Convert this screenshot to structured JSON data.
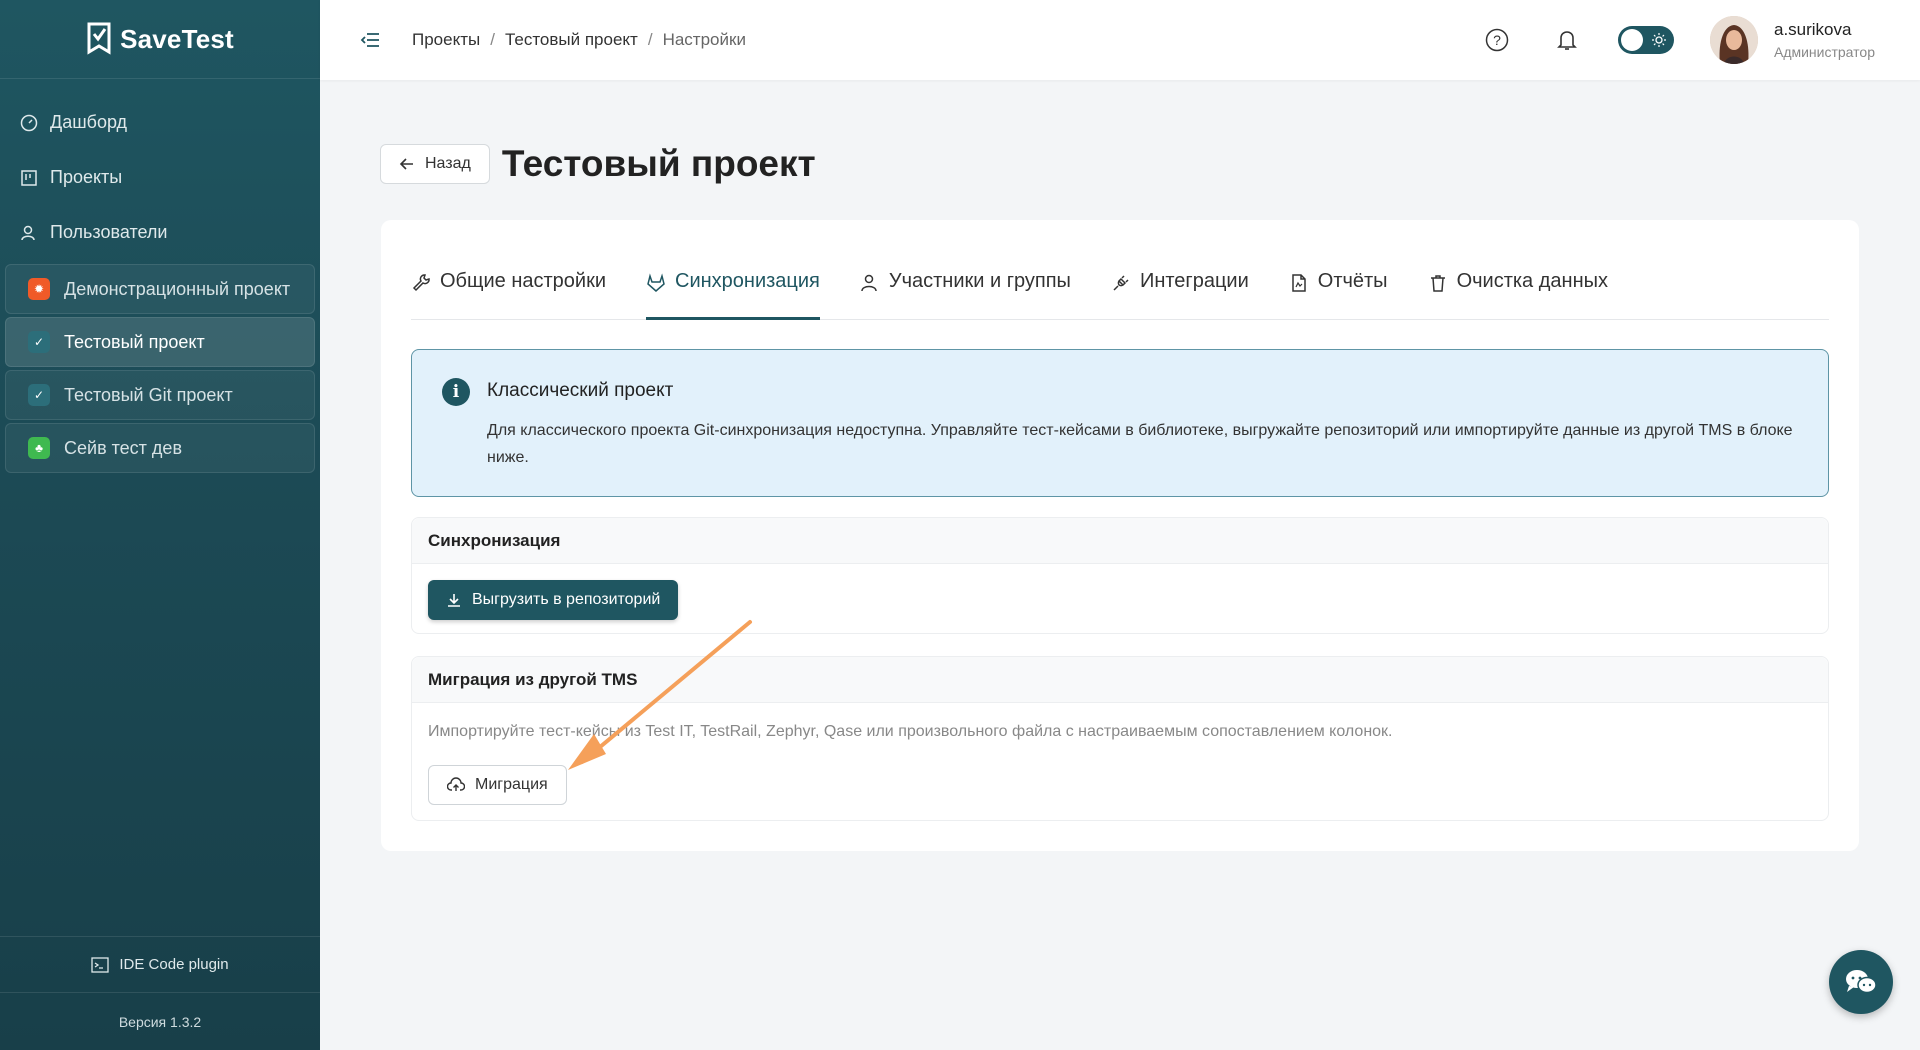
{
  "app": {
    "name": "SaveTest"
  },
  "sidebar": {
    "nav": [
      {
        "label": "Дашборд",
        "icon": "dashboard-icon"
      },
      {
        "label": "Проекты",
        "icon": "projects-icon"
      },
      {
        "label": "Пользователи",
        "icon": "users-icon"
      }
    ],
    "projects": [
      {
        "label": "Демонстрационный проект",
        "color": "#f05a28",
        "icon": "bug-icon"
      },
      {
        "label": "Тестовый проект",
        "color": "#2c6e7a",
        "icon": "savetest-icon",
        "active": true
      },
      {
        "label": "Тестовый Git проект",
        "color": "#2c6e7a",
        "icon": "savetest-icon"
      },
      {
        "label": "Сейв тест дев",
        "color": "#3fb950",
        "icon": "leaf-icon"
      }
    ],
    "ide_plugin": "IDE Code plugin",
    "version": "Версия 1.3.2"
  },
  "header": {
    "breadcrumb": [
      "Проекты",
      "Тестовый проект",
      "Настройки"
    ],
    "user": {
      "name": "a.surikova",
      "role": "Администратор"
    },
    "accent": "#1f5661"
  },
  "page": {
    "back_label": "Назад",
    "title": "Тестовый проект",
    "tabs": [
      {
        "label": "Общие настройки",
        "icon": "wrench-icon"
      },
      {
        "label": "Синхронизация",
        "icon": "gitlab-icon",
        "active": true
      },
      {
        "label": "Участники и группы",
        "icon": "users-icon"
      },
      {
        "label": "Интеграции",
        "icon": "plug-icon"
      },
      {
        "label": "Отчёты",
        "icon": "report-file-icon"
      },
      {
        "label": "Очистка данных",
        "icon": "trash-icon"
      }
    ],
    "info": {
      "title": "Классический проект",
      "text": "Для классического проекта Git-синхронизация недоступна. Управляйте тест-кейсами в библиотеке, выгружайте репозиторий или импортируйте данные из другой TMS в блоке ниже."
    },
    "sync": {
      "title": "Синхронизация",
      "export_label": "Выгрузить в репозиторий"
    },
    "migration": {
      "title": "Миграция из другой TMS",
      "description": "Импортируйте тест-кейсы из Test IT, TestRail, Zephyr, Qase или произвольного файла с настраиваемым сопоставлением колонок.",
      "button_label": "Миграция"
    }
  },
  "annotation": {
    "arrow_color": "#f5a05a"
  }
}
